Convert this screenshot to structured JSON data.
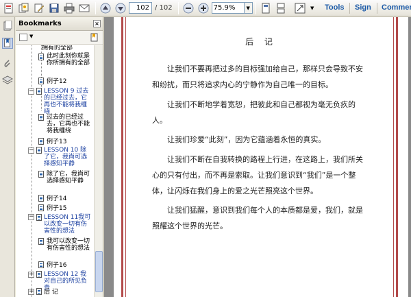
{
  "toolbar": {
    "current_page": "102",
    "total_pages": "/ 102",
    "zoom": "75.9%",
    "tools_label": "Tools",
    "sign_label": "Sign",
    "comment_label": "Comment"
  },
  "bookmarks": {
    "header": "Bookmarks",
    "close_symbol": "×",
    "items": [
      {
        "label": "拥有的全部"
      },
      {
        "label": "此时此刻你就是你所拥有的全部"
      },
      {
        "label": "例子12"
      },
      {
        "label": "LESSON 9 过去的已经过去，它再也不能将我缠绕"
      },
      {
        "label": "过去的已经过去，它再也不能将我缠绕"
      },
      {
        "label": "例子13"
      },
      {
        "label": "LESSON 10 除了它，我尚可选择感知平静"
      },
      {
        "label": "除了它，我尚可选择感知平静"
      },
      {
        "label": "例子14"
      },
      {
        "label": "例子15"
      },
      {
        "label": "LESSON 11我可以改变一切有伤害性的想法"
      },
      {
        "label": "我可以改变一切有伤害性的想法"
      },
      {
        "label": "例子16"
      },
      {
        "label": "LESSON 12 我对自己的所见负责"
      },
      {
        "label": "后 记"
      }
    ]
  },
  "document": {
    "title": "后 记",
    "paragraphs": [
      "让我们不要再把过多的目标强加给自己，那样只会导致不安和纷扰，而只将追求内心的宁静作为自己唯一的目标。",
      "让我们不断地学着宽恕，把彼此和自己都视为毫无负疚的人。",
      "让我们珍爱“此刻”，因为它蕴涵着永恒的真实。",
      "让我们不断在自我转换的路程上行进，在这路上，我们所关心的只有付出，而不再是索取。让我们意识到“我们”是一个整体，让闪烁在我们身上的爱之光芒照亮这个世界。",
      "让我们猛醒，意识到我们每个人的本质都是爱，我们，就是照耀这个世界的光芒。"
    ]
  }
}
